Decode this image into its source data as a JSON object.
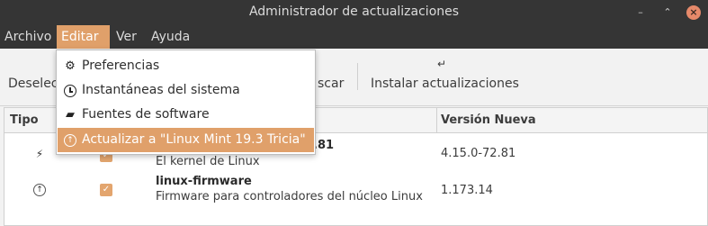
{
  "window": {
    "title": "Administrador de actualizaciones",
    "minimize_icon": "minimize-icon",
    "maximize_icon": "maximize-icon",
    "close_icon": "close-icon",
    "minimize_glyph": "–",
    "maximize_glyph": "⌃",
    "close_glyph": "×",
    "accent_color": "#e0a06a"
  },
  "menubar": {
    "items": [
      {
        "label": "Archivo"
      },
      {
        "label": "Editar",
        "active": true
      },
      {
        "label": "Ver"
      },
      {
        "label": "Ayuda"
      }
    ]
  },
  "toolbar": {
    "deselect_label": "Deselecc",
    "refresh_label": "scar",
    "install_label": "Instalar actualizaciones",
    "install_icon_glyph": "↵"
  },
  "dropdown": {
    "items": [
      {
        "label": "Preferencias",
        "icon": "preferences-icon",
        "glyph": "⚙"
      },
      {
        "label": "Instantáneas del sistema",
        "icon": "clock-icon",
        "glyph": ""
      },
      {
        "label": "Fuentes de software",
        "icon": "package-icon",
        "glyph": "▰"
      },
      {
        "label": "Actualizar a \"Linux Mint 19.3 Tricia\"",
        "icon": "upgrade-icon",
        "glyph": "↑",
        "highlighted": true
      }
    ]
  },
  "table": {
    "columns": {
      "type": "Tipo",
      "new_version": "Versión Nueva"
    },
    "rows": [
      {
        "type_icon": "lightning-icon",
        "type_glyph": "⚡",
        "checked": true,
        "check_glyph": "✓",
        "name_fragment": ".81",
        "description": "El kernel de Linux",
        "version": "4.15.0-72.81"
      },
      {
        "type_icon": "upgrade-icon",
        "type_glyph": "↑",
        "checked": true,
        "check_glyph": "✓",
        "name": "linux-firmware",
        "description": "Firmware para controladores del núcleo Linux",
        "version": "1.173.14"
      }
    ]
  }
}
